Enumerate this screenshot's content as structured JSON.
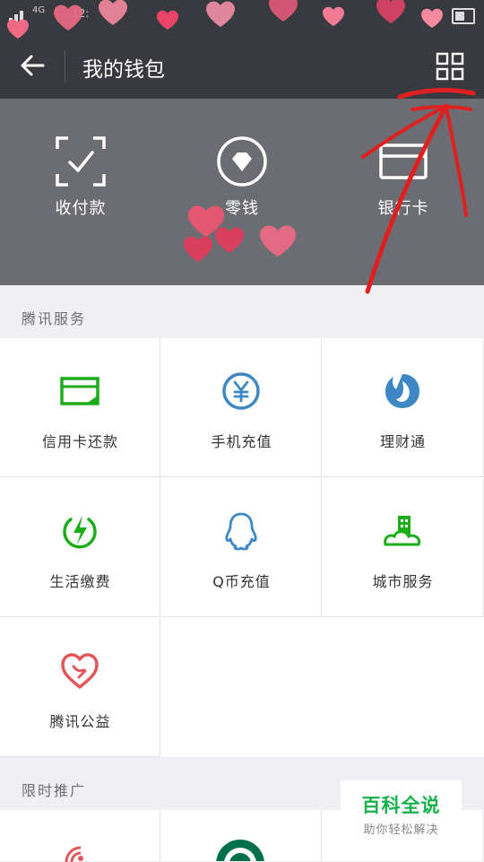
{
  "status": {
    "signal_text": "4G",
    "clock": "12:"
  },
  "header": {
    "title": "我的钱包"
  },
  "wallet": {
    "items": [
      {
        "label": "收付款",
        "icon": "scan-check-icon"
      },
      {
        "label": "零钱",
        "icon": "diamond-coin-icon"
      },
      {
        "label": "银行卡",
        "icon": "bank-card-icon"
      }
    ]
  },
  "tencent_services": {
    "title": "腾讯服务",
    "items": [
      {
        "label": "信用卡还款",
        "icon": "credit-card-icon"
      },
      {
        "label": "手机充值",
        "icon": "yen-coin-icon"
      },
      {
        "label": "理财通",
        "icon": "licaitong-icon"
      },
      {
        "label": "生活缴费",
        "icon": "lightning-icon"
      },
      {
        "label": "Q币充值",
        "icon": "qq-penguin-icon"
      },
      {
        "label": "城市服务",
        "icon": "city-icon"
      },
      {
        "label": "腾讯公益",
        "icon": "heart-charity-icon"
      }
    ]
  },
  "promotions": {
    "title": "限时推广"
  },
  "watermark": {
    "title": "百科全说",
    "subtitle": "助你轻松解决"
  },
  "colors": {
    "titlebar": "#393a3f",
    "wallet_header": "#6b6d72",
    "green": "#1aad19",
    "blue": "#3d88c4",
    "red": "#e0565b",
    "annotation": "#e02020"
  }
}
